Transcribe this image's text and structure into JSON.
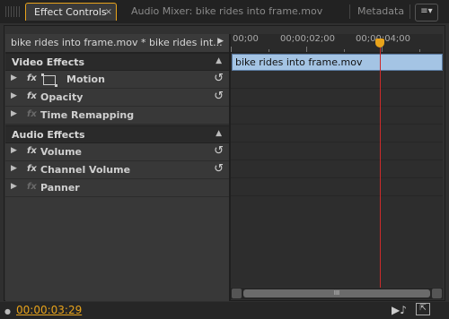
{
  "tabs": {
    "effect_controls": {
      "label": "Effect Controls",
      "close": "×"
    },
    "audio_mixer": {
      "label": "Audio Mixer: bike rides into frame.mov"
    },
    "metadata": {
      "label": "Metadata"
    },
    "menu_icon": "≡▾"
  },
  "clip_header": {
    "label": "bike rides into frame.mov * bike rides int...",
    "arrow": "▶"
  },
  "sections": [
    {
      "label": "Video Effects",
      "caret": "▲"
    },
    {
      "label": "Audio Effects",
      "caret": "▲"
    }
  ],
  "effects": [
    {
      "label": "Motion",
      "fx": "fx",
      "resettable": true
    },
    {
      "label": "Opacity",
      "fx": "fx",
      "resettable": true
    },
    {
      "label": "Time Remapping",
      "fx": "fx",
      "resettable": false
    },
    {
      "label": "Volume",
      "fx": "fx",
      "resettable": true
    },
    {
      "label": "Channel Volume",
      "fx": "fx",
      "resettable": true
    },
    {
      "label": "Panner",
      "fx": "fx",
      "resettable": false
    }
  ],
  "ruler": {
    "labels": [
      "00;00",
      "00;00;02;00",
      "00;00;04;00"
    ]
  },
  "timeline_clip": {
    "label": "bike rides into frame.mov"
  },
  "scrollbar": {
    "thumb_glyph": "III"
  },
  "footer": {
    "timecode": "00:00:03:29",
    "audio_icon": "▶♪"
  },
  "colors": {
    "accent": "#e8a31b",
    "playhead": "#cc2a2a",
    "clip": "#a4c4e4"
  }
}
